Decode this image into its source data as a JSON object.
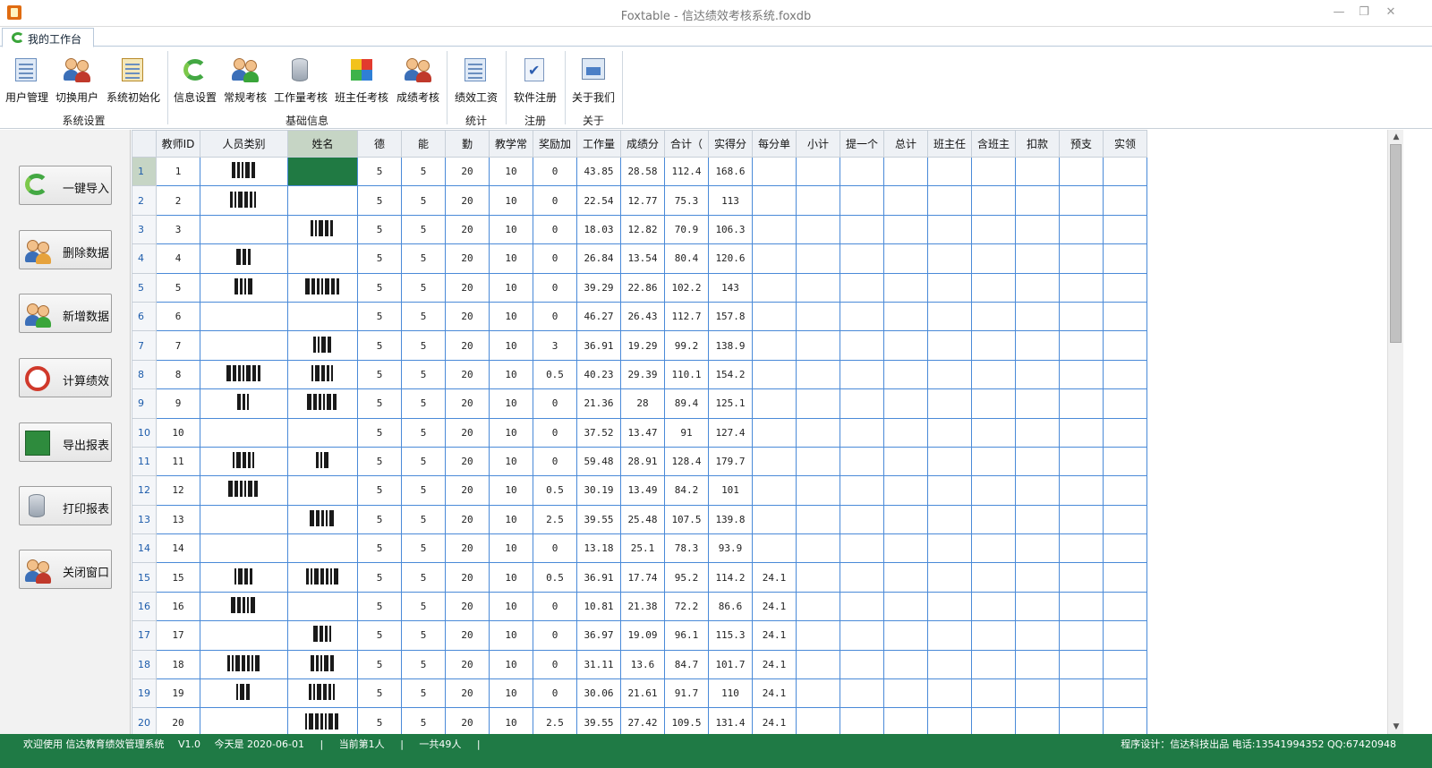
{
  "window": {
    "title": "Foxtable - 信达绩效考核系统.foxdb",
    "min": "—",
    "restore": "❐",
    "close": "✕"
  },
  "tabs": [
    {
      "label": "我的工作台"
    }
  ],
  "ribbon": {
    "groups": [
      {
        "name": "系统设置",
        "buttons": [
          "用户管理",
          "切换用户",
          "系统初始化"
        ]
      },
      {
        "name": "基础信息",
        "buttons": [
          "信息设置",
          "常规考核",
          "工作量考核",
          "班主任考核",
          "成绩考核"
        ]
      },
      {
        "name": "统计",
        "buttons": [
          "绩效工资"
        ]
      },
      {
        "name": "注册",
        "buttons": [
          "软件注册"
        ]
      },
      {
        "name": "关于",
        "buttons": [
          "关于我们"
        ]
      }
    ]
  },
  "side_buttons": [
    "一键导入",
    "删除数据",
    "新增数据",
    "计算绩效",
    "导出报表",
    "打印报表",
    "关闭窗口"
  ],
  "table": {
    "columns": [
      "教师ID",
      "人员类别",
      "姓名",
      "德",
      "能",
      "勤",
      "教学常",
      "奖励加",
      "工作量",
      "成绩分",
      "合计（",
      "实得分",
      "每分单",
      "小计",
      "提一个",
      "总计",
      "班主任",
      "含班主",
      "扣款",
      "预支",
      "实领"
    ],
    "selected_column": 2,
    "current_row": 0,
    "rows": [
      {
        "id": "1",
        "de": "5",
        "neng": "5",
        "qin": "20",
        "jxc": "10",
        "jlj": "0",
        "gzl": "43.85",
        "cjf": "28.58",
        "hj": "112.4",
        "sdf": "168.6",
        "mfd": ""
      },
      {
        "id": "2",
        "de": "5",
        "neng": "5",
        "qin": "20",
        "jxc": "10",
        "jlj": "0",
        "gzl": "22.54",
        "cjf": "12.77",
        "hj": "75.3",
        "sdf": "113",
        "mfd": ""
      },
      {
        "id": "3",
        "de": "5",
        "neng": "5",
        "qin": "20",
        "jxc": "10",
        "jlj": "0",
        "gzl": "18.03",
        "cjf": "12.82",
        "hj": "70.9",
        "sdf": "106.3",
        "mfd": ""
      },
      {
        "id": "4",
        "de": "5",
        "neng": "5",
        "qin": "20",
        "jxc": "10",
        "jlj": "0",
        "gzl": "26.84",
        "cjf": "13.54",
        "hj": "80.4",
        "sdf": "120.6",
        "mfd": ""
      },
      {
        "id": "5",
        "de": "5",
        "neng": "5",
        "qin": "20",
        "jxc": "10",
        "jlj": "0",
        "gzl": "39.29",
        "cjf": "22.86",
        "hj": "102.2",
        "sdf": "143",
        "mfd": ""
      },
      {
        "id": "6",
        "de": "5",
        "neng": "5",
        "qin": "20",
        "jxc": "10",
        "jlj": "0",
        "gzl": "46.27",
        "cjf": "26.43",
        "hj": "112.7",
        "sdf": "157.8",
        "mfd": ""
      },
      {
        "id": "7",
        "de": "5",
        "neng": "5",
        "qin": "20",
        "jxc": "10",
        "jlj": "3",
        "gzl": "36.91",
        "cjf": "19.29",
        "hj": "99.2",
        "sdf": "138.9",
        "mfd": ""
      },
      {
        "id": "8",
        "de": "5",
        "neng": "5",
        "qin": "20",
        "jxc": "10",
        "jlj": "0.5",
        "gzl": "40.23",
        "cjf": "29.39",
        "hj": "110.1",
        "sdf": "154.2",
        "mfd": ""
      },
      {
        "id": "9",
        "de": "5",
        "neng": "5",
        "qin": "20",
        "jxc": "10",
        "jlj": "0",
        "gzl": "21.36",
        "cjf": "28",
        "hj": "89.4",
        "sdf": "125.1",
        "mfd": ""
      },
      {
        "id": "10",
        "de": "5",
        "neng": "5",
        "qin": "20",
        "jxc": "10",
        "jlj": "0",
        "gzl": "37.52",
        "cjf": "13.47",
        "hj": "91",
        "sdf": "127.4",
        "mfd": ""
      },
      {
        "id": "11",
        "de": "5",
        "neng": "5",
        "qin": "20",
        "jxc": "10",
        "jlj": "0",
        "gzl": "59.48",
        "cjf": "28.91",
        "hj": "128.4",
        "sdf": "179.7",
        "mfd": ""
      },
      {
        "id": "12",
        "de": "5",
        "neng": "5",
        "qin": "20",
        "jxc": "10",
        "jlj": "0.5",
        "gzl": "30.19",
        "cjf": "13.49",
        "hj": "84.2",
        "sdf": "101",
        "mfd": ""
      },
      {
        "id": "13",
        "de": "5",
        "neng": "5",
        "qin": "20",
        "jxc": "10",
        "jlj": "2.5",
        "gzl": "39.55",
        "cjf": "25.48",
        "hj": "107.5",
        "sdf": "139.8",
        "mfd": ""
      },
      {
        "id": "14",
        "de": "5",
        "neng": "5",
        "qin": "20",
        "jxc": "10",
        "jlj": "0",
        "gzl": "13.18",
        "cjf": "25.1",
        "hj": "78.3",
        "sdf": "93.9",
        "mfd": ""
      },
      {
        "id": "15",
        "de": "5",
        "neng": "5",
        "qin": "20",
        "jxc": "10",
        "jlj": "0.5",
        "gzl": "36.91",
        "cjf": "17.74",
        "hj": "95.2",
        "sdf": "114.2",
        "mfd": "24.1"
      },
      {
        "id": "16",
        "de": "5",
        "neng": "5",
        "qin": "20",
        "jxc": "10",
        "jlj": "0",
        "gzl": "10.81",
        "cjf": "21.38",
        "hj": "72.2",
        "sdf": "86.6",
        "mfd": "24.1"
      },
      {
        "id": "17",
        "de": "5",
        "neng": "5",
        "qin": "20",
        "jxc": "10",
        "jlj": "0",
        "gzl": "36.97",
        "cjf": "19.09",
        "hj": "96.1",
        "sdf": "115.3",
        "mfd": "24.1"
      },
      {
        "id": "18",
        "de": "5",
        "neng": "5",
        "qin": "20",
        "jxc": "10",
        "jlj": "0",
        "gzl": "31.11",
        "cjf": "13.6",
        "hj": "84.7",
        "sdf": "101.7",
        "mfd": "24.1"
      },
      {
        "id": "19",
        "de": "5",
        "neng": "5",
        "qin": "20",
        "jxc": "10",
        "jlj": "0",
        "gzl": "30.06",
        "cjf": "21.61",
        "hj": "91.7",
        "sdf": "110",
        "mfd": "24.1"
      },
      {
        "id": "20",
        "de": "5",
        "neng": "5",
        "qin": "20",
        "jxc": "10",
        "jlj": "2.5",
        "gzl": "39.55",
        "cjf": "27.42",
        "hj": "109.5",
        "sdf": "131.4",
        "mfd": "24.1"
      }
    ]
  },
  "status": {
    "welcome": "欢迎使用 信达教育绩效管理系统",
    "version": "V1.0",
    "today": "今天是 2020-06-01",
    "current": "当前第1人",
    "total": "一共49人",
    "designer": "程序设计：信达科技出品 电话:13541994352 QQ:67420948"
  },
  "colors": {
    "accent_green": "#1f7a45",
    "grid_border": "#4a8ad8",
    "selection": "#207a43"
  }
}
